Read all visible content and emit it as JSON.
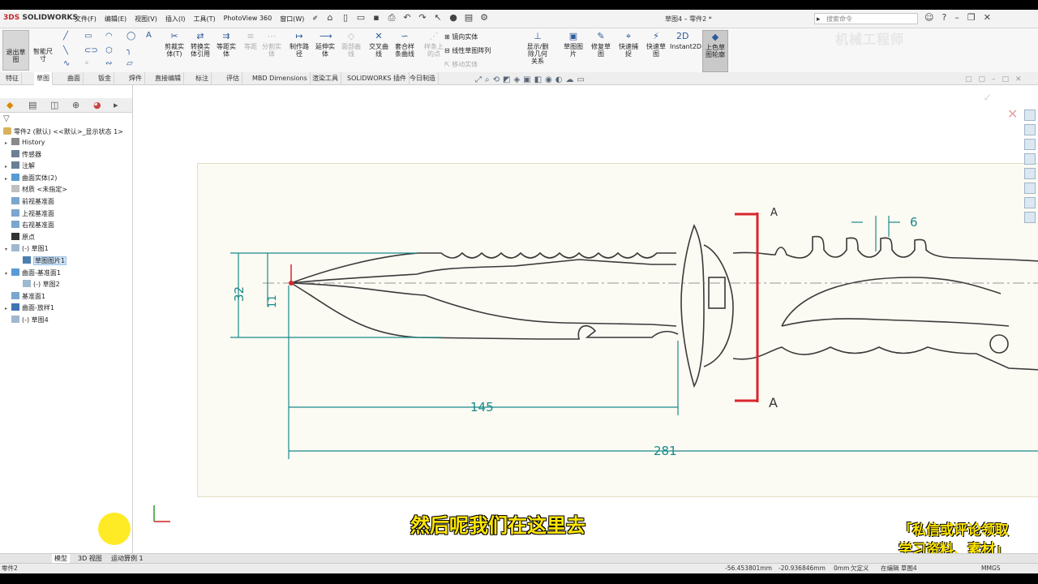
{
  "app": {
    "logo_ds": "3DS",
    "logo_text": "SOLIDWORKS",
    "document_title": "草图4 – 零件2 *"
  },
  "menu": [
    "文件(F)",
    "编辑(E)",
    "视图(V)",
    "插入(I)",
    "工具(T)",
    "PhotoView 360",
    "窗口(W)"
  ],
  "search": {
    "placeholder": "搜索命令"
  },
  "ribbon": {
    "exit_sketch": "退出草图",
    "smart_dimension": "智能尺寸",
    "tools": [
      {
        "label": "剪裁实体(T)",
        "enabled": true
      },
      {
        "label": "转换实体引用",
        "enabled": true
      },
      {
        "label": "等距实体",
        "enabled": true
      },
      {
        "label": "等距",
        "enabled": false
      },
      {
        "label": "分割实体",
        "enabled": false
      },
      {
        "label": "制作路径",
        "enabled": true
      },
      {
        "label": "延伸实体",
        "enabled": true
      },
      {
        "label": "面部曲线",
        "enabled": false
      },
      {
        "label": "交叉曲线",
        "enabled": true
      },
      {
        "label": "套合样条曲线",
        "enabled": true
      },
      {
        "label": "样条上的点",
        "enabled": false
      },
      {
        "label": "显示/删除几何关系",
        "enabled": true
      },
      {
        "label": "草图图片",
        "enabled": true
      },
      {
        "label": "修复草图",
        "enabled": true
      },
      {
        "label": "快速捕捉",
        "enabled": true
      },
      {
        "label": "快速草图",
        "enabled": true
      },
      {
        "label": "Instant2D",
        "enabled": true
      },
      {
        "label": "上色草图轮廓",
        "enabled": true
      }
    ],
    "mirror_list": [
      {
        "label": "镜向实体",
        "enabled": true
      },
      {
        "label": "线性草图阵列",
        "enabled": true
      },
      {
        "label": "移动实体",
        "enabled": false
      }
    ],
    "watermark": "机械工程师"
  },
  "tabs": [
    "特征",
    "草图",
    "曲面",
    "钣金",
    "焊件",
    "直接编辑",
    "标注",
    "评估",
    "MBD Dimensions",
    "渲染工具",
    "SOLIDWORKS 插件",
    "今日制造"
  ],
  "active_tab": "草图",
  "tree": {
    "root": "零件2 (默认) <<默认>_显示状态 1>",
    "items": [
      {
        "label": "History",
        "expand": "▸",
        "icon": "history",
        "indent": 0
      },
      {
        "label": "传感器",
        "expand": "",
        "icon": "sensor",
        "indent": 0
      },
      {
        "label": "注解",
        "expand": "▸",
        "icon": "annotation",
        "indent": 0
      },
      {
        "label": "曲面实体(2)",
        "expand": "▸",
        "icon": "surface",
        "indent": 0
      },
      {
        "label": "材质 <未指定>",
        "expand": "",
        "icon": "material",
        "indent": 0
      },
      {
        "label": "前视基准面",
        "expand": "",
        "icon": "plane",
        "indent": 0
      },
      {
        "label": "上视基准面",
        "expand": "",
        "icon": "plane",
        "indent": 0
      },
      {
        "label": "右视基准面",
        "expand": "",
        "icon": "plane",
        "indent": 0
      },
      {
        "label": "原点",
        "expand": "",
        "icon": "origin",
        "indent": 0
      },
      {
        "label": "(-) 草图1",
        "expand": "▾",
        "icon": "sketch",
        "indent": 0
      },
      {
        "label": "草图图片1",
        "expand": "",
        "icon": "picture",
        "indent": 1,
        "selected": true
      },
      {
        "label": "曲面-基准面1",
        "expand": "▾",
        "icon": "surface",
        "indent": 0
      },
      {
        "label": "(-) 草图2",
        "expand": "",
        "icon": "sketch",
        "indent": 1
      },
      {
        "label": "基准面1",
        "expand": "",
        "icon": "plane",
        "indent": 0
      },
      {
        "label": "曲面-放样1",
        "expand": "▸",
        "icon": "loft",
        "indent": 0
      },
      {
        "label": "(-) 草图4",
        "expand": "",
        "icon": "sketch",
        "indent": 0
      }
    ]
  },
  "drawing": {
    "dim_32": "32",
    "dim_11": "11",
    "dim_145": "145",
    "dim_281": "281",
    "dim_6": "6",
    "section_a_top": "A",
    "section_a_bottom": "A"
  },
  "subtitle": "然后呢我们在这里去",
  "promo": {
    "line1": "「私信或评论领取",
    "line2": "学习资料、素材」"
  },
  "bottom_tabs": [
    "模型",
    "3D 视图",
    "运动算例 1"
  ],
  "status": {
    "left": "零件2",
    "x": "-56.453801mm",
    "y": "-20.936846mm",
    "z": "0mm",
    "defined": "欠定义",
    "editing": "在编辑 草图4",
    "units": "MMGS"
  }
}
